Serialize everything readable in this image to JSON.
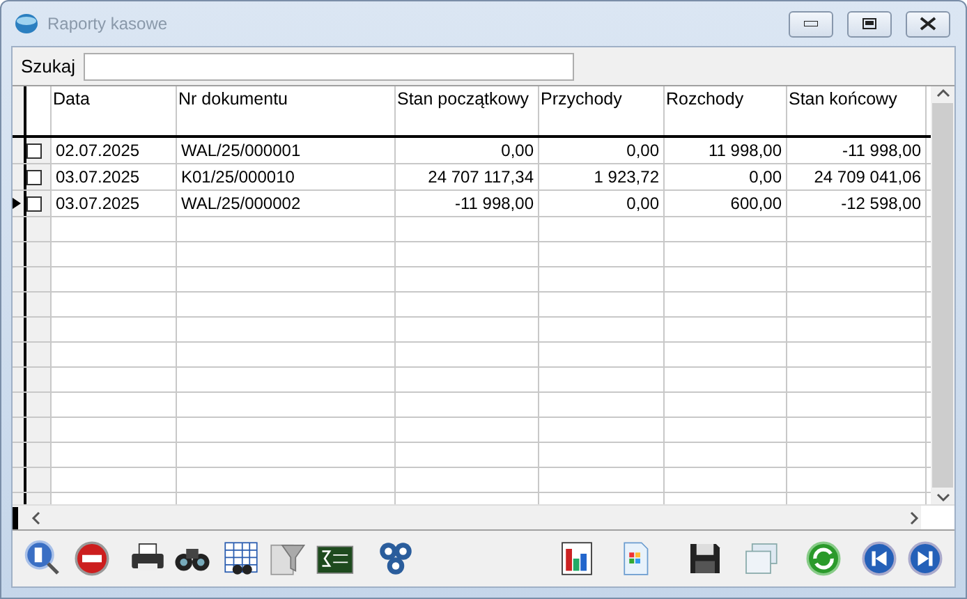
{
  "window": {
    "title": "Raporty kasowe"
  },
  "search": {
    "label": "Szukaj"
  },
  "table": {
    "columns": [
      "Data",
      "Nr dokumentu",
      "Stan początkowy",
      "Przychody",
      "Rozchody",
      "Stan końcowy"
    ],
    "rows": [
      {
        "cells": [
          "02.07.2025",
          "WAL/25/000001",
          "0,00",
          "0,00",
          "11 998,00",
          "-11 998,00"
        ],
        "checked": false,
        "current": false
      },
      {
        "cells": [
          "03.07.2025",
          "K01/25/000010",
          "24 707 117,34",
          "1 923,72",
          "0,00",
          "24 709 041,06"
        ],
        "checked": false,
        "current": false
      },
      {
        "cells": [
          "03.07.2025",
          "WAL/25/000002",
          "-11 998,00",
          "0,00",
          "600,00",
          "-12 598,00"
        ],
        "checked": false,
        "current": true
      }
    ]
  }
}
